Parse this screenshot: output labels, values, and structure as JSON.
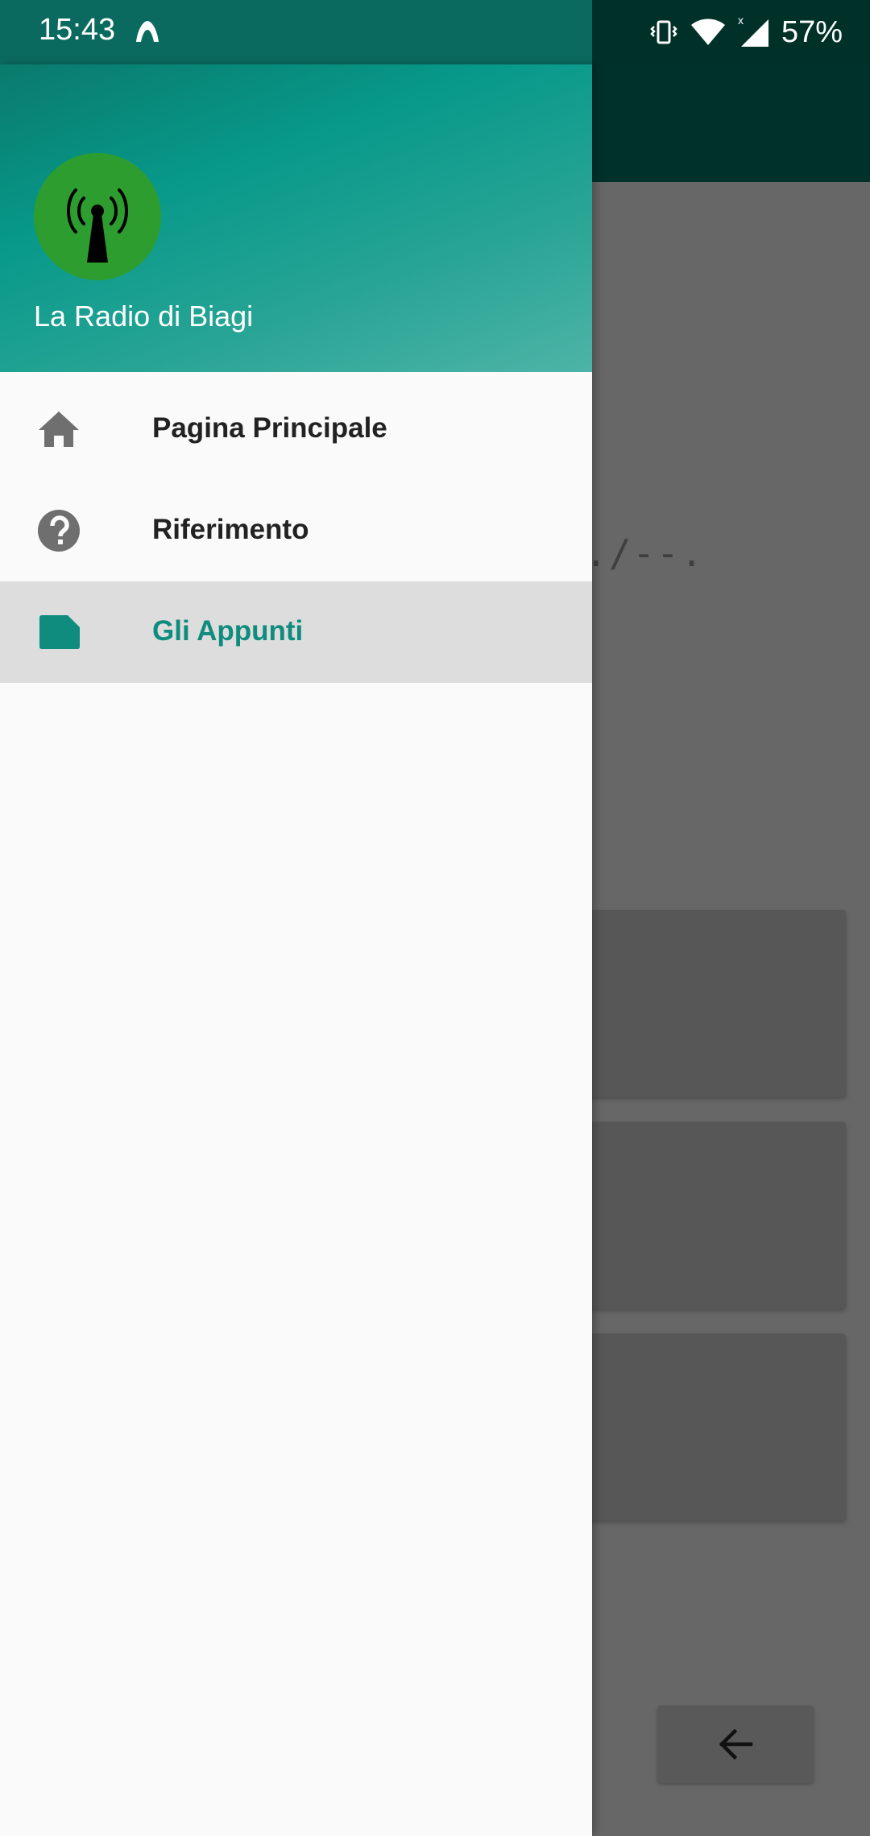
{
  "status_bar": {
    "time": "15:43",
    "notification_icon": "mountain-notification-icon",
    "battery_percent": "57%",
    "icons": [
      "vibrate-icon",
      "wifi-icon",
      "cell-signal-icon"
    ]
  },
  "background": {
    "morse_text": "./--.",
    "back_button_icon": "arrow-left-icon"
  },
  "drawer": {
    "header": {
      "app_name": "La Radio di Biagi",
      "logo_icon": "radio-tower-icon"
    },
    "items": [
      {
        "label": "Pagina Principale",
        "icon": "home-icon",
        "active": false
      },
      {
        "label": "Riferimento",
        "icon": "help-icon",
        "active": false
      },
      {
        "label": "Gli Appunti",
        "icon": "note-icon",
        "active": true
      }
    ]
  },
  "colors": {
    "accent": "#0f8c7d",
    "header_start": "#07998a",
    "header_end": "#4db4a7",
    "avatar_bg": "#2e9d2f",
    "appbar_dark": "#00312b"
  }
}
